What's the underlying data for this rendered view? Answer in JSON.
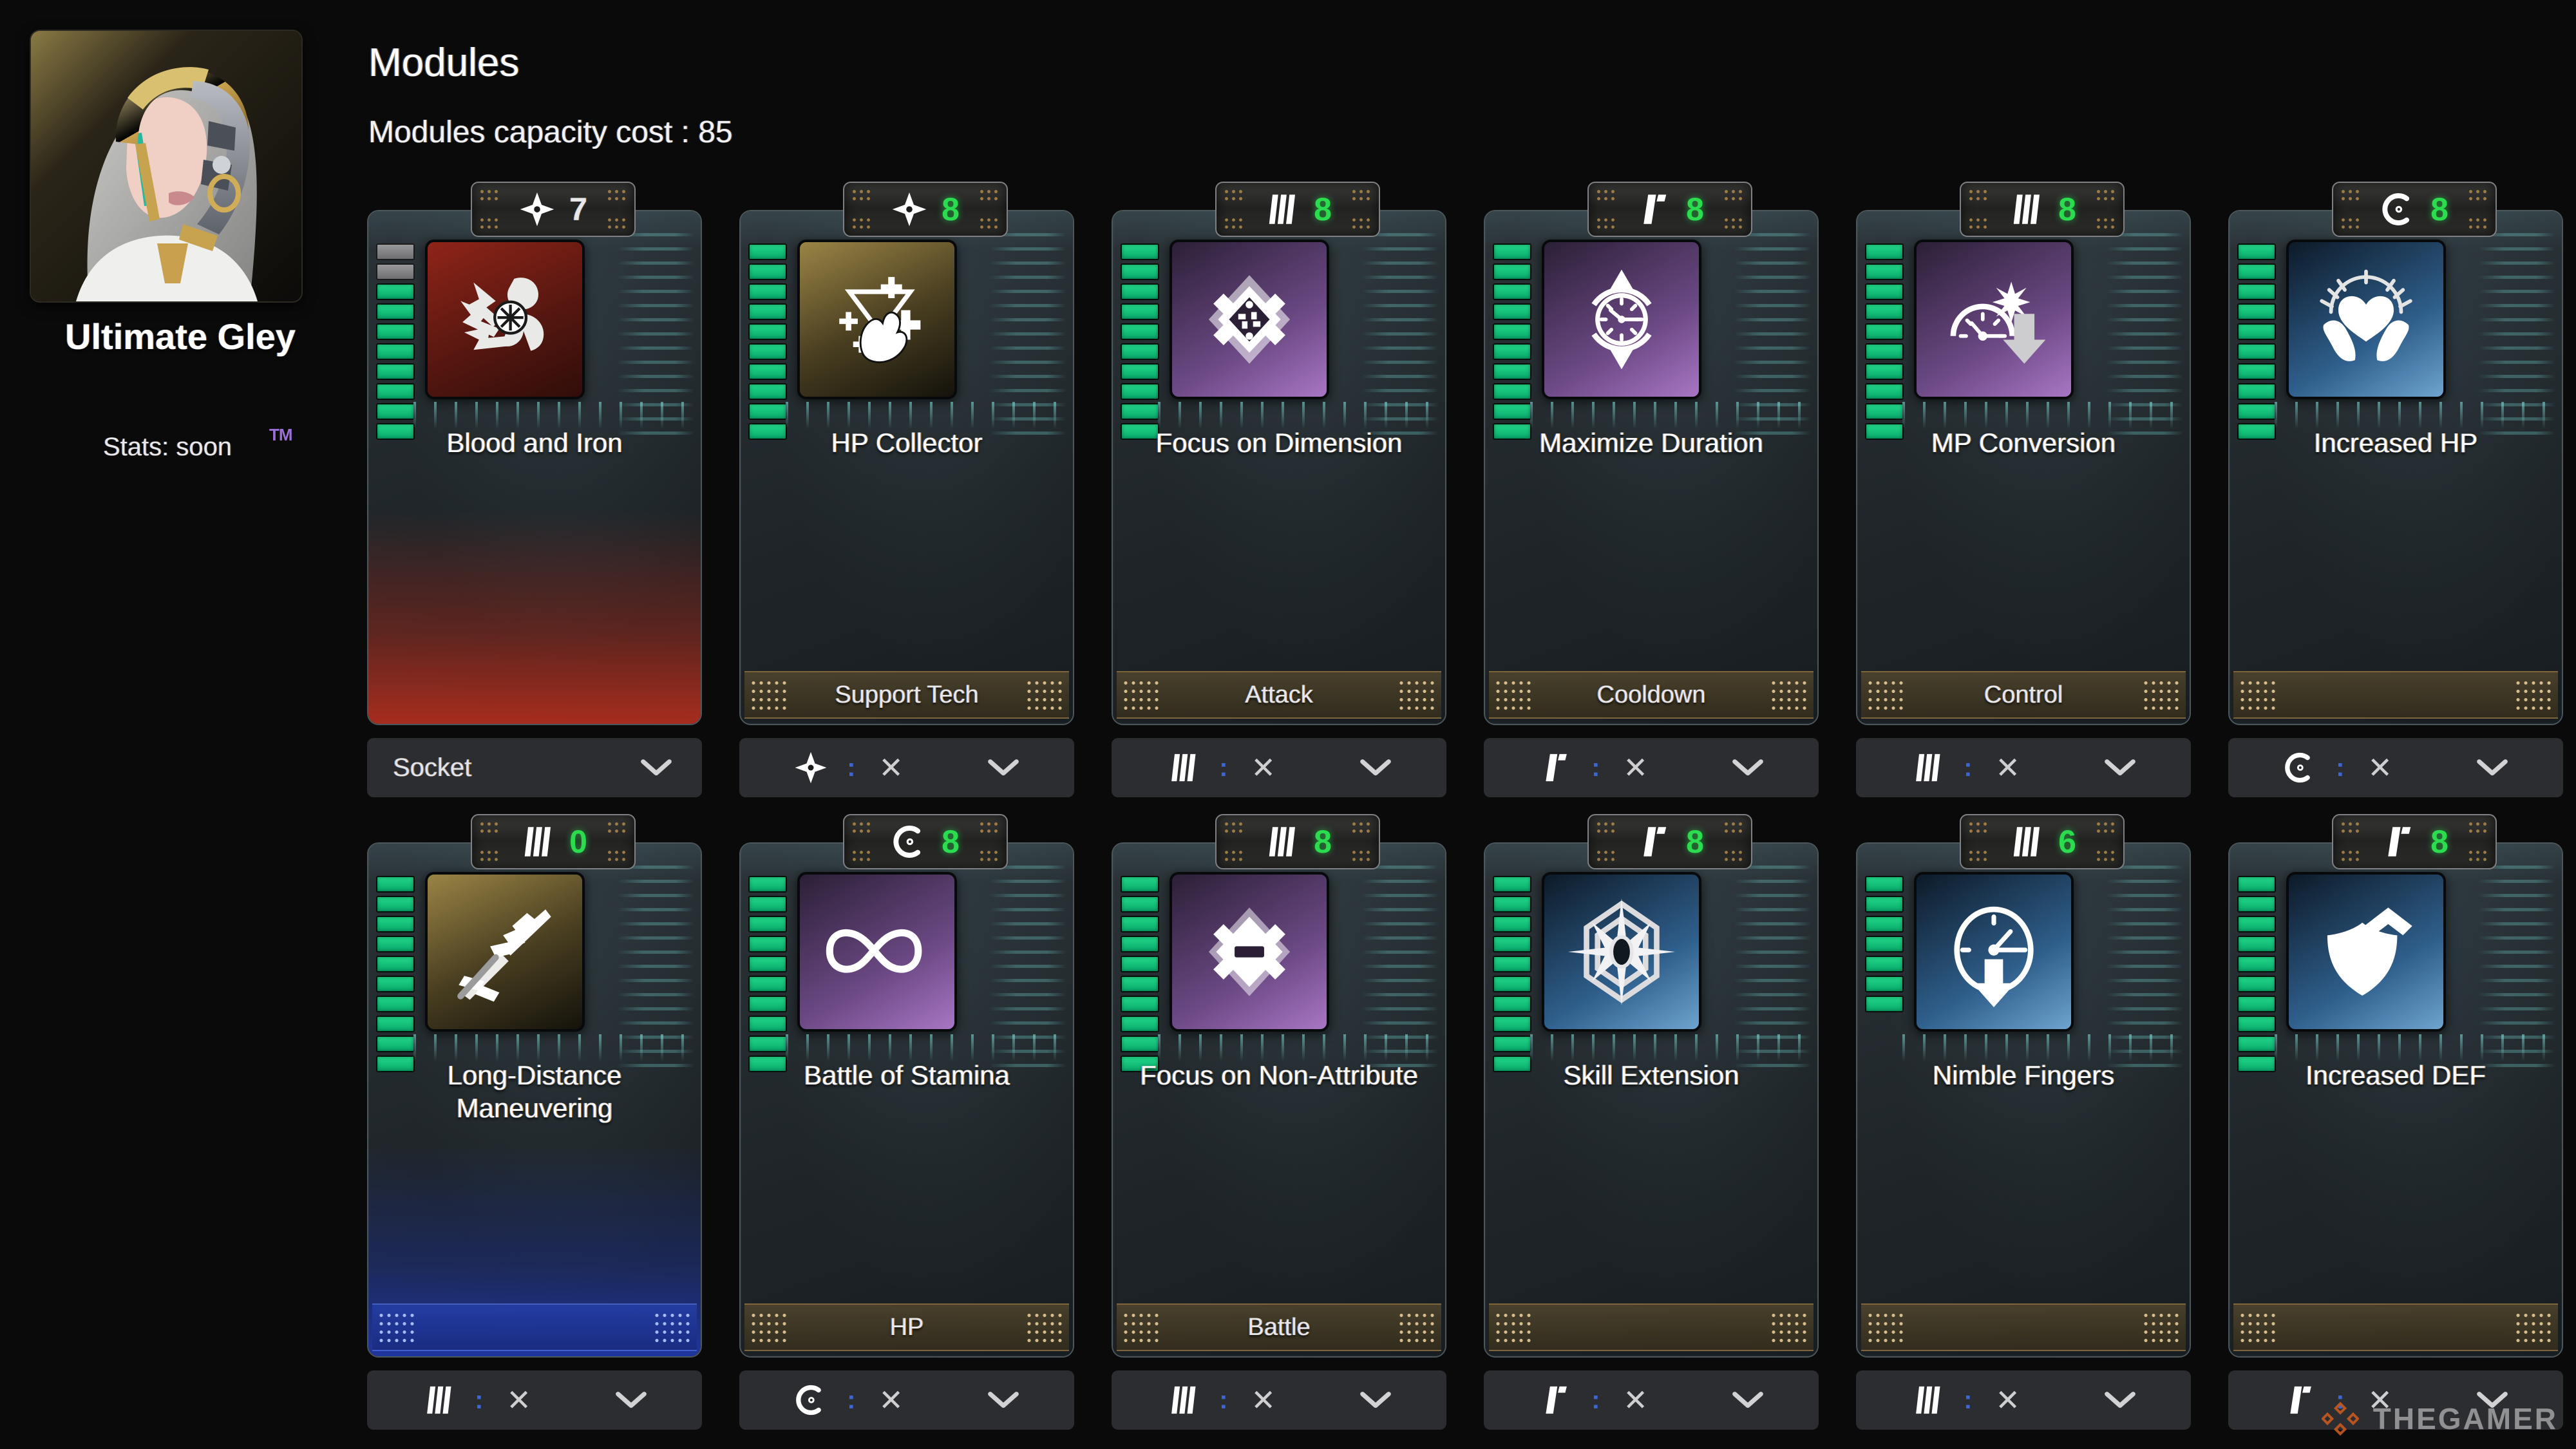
{
  "character": {
    "name": "Ultimate Gley",
    "stats_label": "Stats: soon",
    "trademark": "TM"
  },
  "header": {
    "title": "Modules",
    "capacity_line": "Modules capacity cost : 85",
    "capacity_cost": 85
  },
  "watermark": {
    "text": "THEGAMER",
    "logo_color": "#c4581f"
  },
  "socket_label": "Socket",
  "colors": {
    "level_on": "#17c97c",
    "level_off": "#8a8a8c",
    "badge_green": "#2bdd4e",
    "accent_orange": "#c4581f"
  },
  "modules": [
    {
      "name": "Blood and Iron",
      "badge_icon": "shuriken-icon",
      "badge_value": "7",
      "badge_value_color": "plain",
      "tile_color": "red",
      "icon": "blood-and-iron-icon",
      "level_on": 8,
      "level_off": 2,
      "category": "",
      "category_plate": "none",
      "card_tint": "red",
      "control": {
        "type": "socket",
        "label": "Socket",
        "icon": "",
        "remove": "",
        "chevron": "chevron-down-icon"
      }
    },
    {
      "name": "HP Collector",
      "badge_icon": "shuriken-icon",
      "badge_value": "8",
      "badge_value_color": "green",
      "tile_color": "gold",
      "icon": "hp-collector-icon",
      "level_on": 10,
      "level_off": 0,
      "category": "Support Tech",
      "category_plate": "gold",
      "card_tint": "none",
      "control": {
        "type": "module",
        "label": "",
        "icon": "shuriken-icon",
        "remove": "✕",
        "chevron": "chevron-down-icon"
      }
    },
    {
      "name": "Focus on Dimension",
      "badge_icon": "three-bars-icon",
      "badge_value": "8",
      "badge_value_color": "green",
      "tile_color": "purple",
      "icon": "focus-on-dimension-icon",
      "level_on": 10,
      "level_off": 0,
      "category": "Attack",
      "category_plate": "gold",
      "card_tint": "none",
      "control": {
        "type": "module",
        "label": "",
        "icon": "three-bars-icon",
        "remove": "✕",
        "chevron": "chevron-down-icon"
      }
    },
    {
      "name": "Maximize Duration",
      "badge_icon": "flag-icon",
      "badge_value": "8",
      "badge_value_color": "green",
      "tile_color": "purple",
      "icon": "maximize-duration-icon",
      "level_on": 10,
      "level_off": 0,
      "category": "Cooldown",
      "category_plate": "gold",
      "card_tint": "none",
      "control": {
        "type": "module",
        "label": "",
        "icon": "flag-icon",
        "remove": "✕",
        "chevron": "chevron-down-icon"
      }
    },
    {
      "name": "MP Conversion",
      "badge_icon": "three-bars-icon",
      "badge_value": "8",
      "badge_value_color": "green",
      "tile_color": "purple",
      "icon": "mp-conversion-icon",
      "level_on": 10,
      "level_off": 0,
      "category": "Control",
      "category_plate": "gold",
      "card_tint": "none",
      "control": {
        "type": "module",
        "label": "",
        "icon": "three-bars-icon",
        "remove": "✕",
        "chevron": "chevron-down-icon"
      }
    },
    {
      "name": "Increased HP",
      "badge_icon": "c-circle-icon",
      "badge_value": "8",
      "badge_value_color": "green",
      "tile_color": "blue",
      "icon": "increased-hp-icon",
      "level_on": 10,
      "level_off": 0,
      "category": "",
      "category_plate": "gold",
      "card_tint": "none",
      "control": {
        "type": "module",
        "label": "",
        "icon": "c-circle-icon",
        "remove": "✕",
        "chevron": "chevron-down-icon"
      }
    },
    {
      "name": "Long-Distance Maneuvering",
      "badge_icon": "three-bars-icon",
      "badge_value": "0",
      "badge_value_color": "green",
      "tile_color": "gold",
      "icon": "long-distance-maneuvering-icon",
      "level_on": 10,
      "level_off": 0,
      "category": "",
      "category_plate": "blue",
      "card_tint": "blue",
      "control": {
        "type": "module",
        "label": "",
        "icon": "three-bars-icon",
        "remove": "✕",
        "chevron": "chevron-down-icon"
      }
    },
    {
      "name": "Battle of Stamina",
      "badge_icon": "c-circle-icon",
      "badge_value": "8",
      "badge_value_color": "green",
      "tile_color": "purple",
      "icon": "battle-of-stamina-icon",
      "level_on": 10,
      "level_off": 0,
      "category": "HP",
      "category_plate": "gold",
      "card_tint": "none",
      "control": {
        "type": "module",
        "label": "",
        "icon": "c-circle-icon",
        "remove": "✕",
        "chevron": "chevron-down-icon"
      }
    },
    {
      "name": "Focus on Non-Attribute",
      "badge_icon": "three-bars-icon",
      "badge_value": "8",
      "badge_value_color": "green",
      "tile_color": "purple",
      "icon": "focus-on-non-attribute-icon",
      "level_on": 10,
      "level_off": 0,
      "category": "Battle",
      "category_plate": "gold",
      "card_tint": "none",
      "control": {
        "type": "module",
        "label": "",
        "icon": "three-bars-icon",
        "remove": "✕",
        "chevron": "chevron-down-icon"
      }
    },
    {
      "name": "Skill Extension",
      "badge_icon": "flag-icon",
      "badge_value": "8",
      "badge_value_color": "green",
      "tile_color": "blue",
      "icon": "skill-extension-icon",
      "level_on": 10,
      "level_off": 0,
      "category": "",
      "category_plate": "gold",
      "card_tint": "none",
      "control": {
        "type": "module",
        "label": "",
        "icon": "flag-icon",
        "remove": "✕",
        "chevron": "chevron-down-icon"
      }
    },
    {
      "name": "Nimble Fingers",
      "badge_icon": "three-bars-icon",
      "badge_value": "6",
      "badge_value_color": "green",
      "tile_color": "blue",
      "icon": "nimble-fingers-icon",
      "level_on": 7,
      "level_off": 0,
      "category": "",
      "category_plate": "gold",
      "card_tint": "none",
      "control": {
        "type": "module",
        "label": "",
        "icon": "three-bars-icon",
        "remove": "✕",
        "chevron": "chevron-down-icon"
      }
    },
    {
      "name": "Increased DEF",
      "badge_icon": "flag-icon",
      "badge_value": "8",
      "badge_value_color": "green",
      "tile_color": "blue",
      "icon": "increased-def-icon",
      "level_on": 10,
      "level_off": 0,
      "category": "",
      "category_plate": "gold",
      "card_tint": "none",
      "control": {
        "type": "module",
        "label": "",
        "icon": "flag-icon",
        "remove": "✕",
        "chevron": "chevron-down-icon"
      }
    }
  ]
}
